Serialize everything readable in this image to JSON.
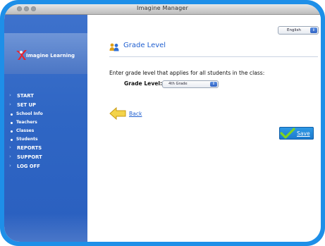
{
  "window": {
    "title": "Imagine Manager"
  },
  "brand": {
    "name": "Imagine Learning"
  },
  "nav": {
    "start": "START",
    "setup": "SET UP",
    "school_info": "School Info",
    "teachers": "Teachers",
    "classes": "Classes",
    "students": "Students",
    "reports": "REPORTS",
    "support": "SUPPORT",
    "logoff": "LOG OFF"
  },
  "language_select": {
    "value": "English"
  },
  "page": {
    "title": "Grade Level",
    "instruction": "Enter grade level that applies for all students in the class:",
    "grade_label": "Grade Level:",
    "grade_value": "4th Grade"
  },
  "actions": {
    "back": "Back",
    "save": "Save"
  },
  "colors": {
    "accent": "#1f5fd0",
    "sidebar": "#2f66c4",
    "frame": "#1e8fe8",
    "save_button": "#2f9be6"
  },
  "icons": [
    "people-icon",
    "back-arrow-icon",
    "checkmark-icon",
    "imagine-learning-logo-icon"
  ]
}
